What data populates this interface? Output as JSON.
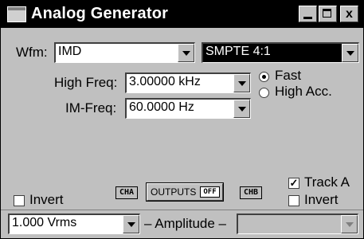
{
  "window": {
    "title": "Analog Generator"
  },
  "titlebar": {
    "minimize": "_",
    "maximize": "□",
    "close": "x"
  },
  "waveform": {
    "label": "Wfm:",
    "value": "IMD",
    "type_value": "SMPTE 4:1"
  },
  "high_freq": {
    "label": "High Freq:",
    "value": "3.00000 kHz"
  },
  "im_freq": {
    "label": "IM-Freq:",
    "value": "60.0000  Hz"
  },
  "accuracy": {
    "fast": "Fast",
    "high_acc": "High Acc.",
    "selected": "Fast"
  },
  "channel_a": {
    "invert": "Invert",
    "chip": "CHA",
    "invert_checked": false
  },
  "outputs": {
    "label": "OUTPUTS",
    "state": "OFF"
  },
  "channel_b": {
    "chip": "CHB",
    "track_a": "Track A",
    "track_a_checked": true,
    "invert": "Invert",
    "invert_checked": false
  },
  "amplitude": {
    "value": "1.000   Vrms",
    "label": "– Amplitude –",
    "b_value": ""
  },
  "icons": {
    "app": "window-app-icon",
    "minimize": "minimize-icon",
    "maximize": "maximize-icon",
    "close": "close-icon",
    "dropdown": "chevron-down-icon"
  },
  "colors": {
    "titlebar": "#000000",
    "face": "#c0c0c0",
    "field": "#ffffff",
    "selected_field": "#000000"
  }
}
